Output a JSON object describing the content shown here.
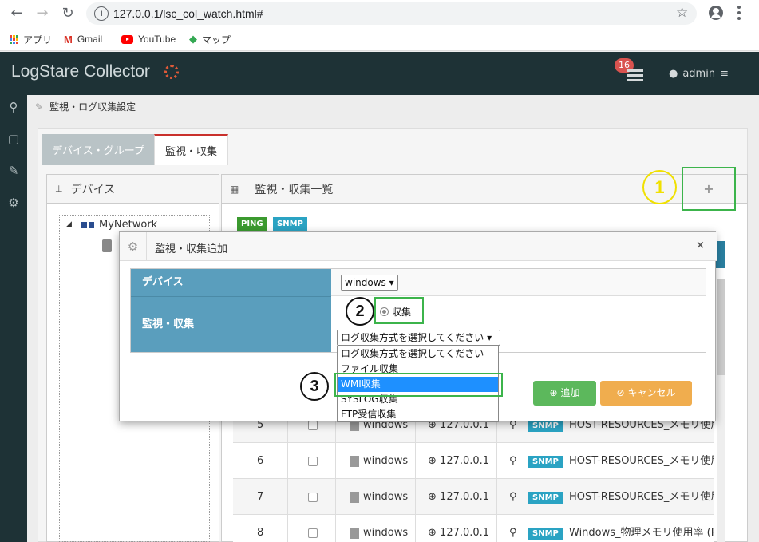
{
  "browser": {
    "url": "127.0.0.1/lsc_col_watch.html#",
    "bookmarks": [
      {
        "label": "アプリ"
      },
      {
        "label": "Gmail"
      },
      {
        "label": "YouTube"
      },
      {
        "label": "マップ"
      }
    ]
  },
  "header": {
    "brand": "LogStare Collector",
    "notification_count": "16",
    "user": "admin"
  },
  "breadcrumb": {
    "label": "監視・ログ収集設定"
  },
  "tabs": [
    {
      "label": "デバイス・グループ",
      "active": false
    },
    {
      "label": "監視・収集",
      "active": true
    }
  ],
  "left_panel": {
    "title": "デバイス",
    "tree": {
      "root": "MyNetwork"
    }
  },
  "right_panel": {
    "title": "監視・収集一覧",
    "add_symbol": "+",
    "chips": [
      "PING",
      "SNMP"
    ]
  },
  "annotations": {
    "one": "1",
    "two": "2",
    "three": "3"
  },
  "table": {
    "rows": [
      {
        "no": "5",
        "device": "windows",
        "ip": "127.0.0.1",
        "type": "SNMP",
        "name": "HOST-RESOURCES_メモリ使用率"
      },
      {
        "no": "6",
        "device": "windows",
        "ip": "127.0.0.1",
        "type": "SNMP",
        "name": "HOST-RESOURCES_メモリ使用率"
      },
      {
        "no": "7",
        "device": "windows",
        "ip": "127.0.0.1",
        "type": "SNMP",
        "name": "HOST-RESOURCES_メモリ使用率"
      },
      {
        "no": "8",
        "device": "windows",
        "ip": "127.0.0.1",
        "type": "SNMP",
        "name": "Windows_物理メモリ使用率 (Ph"
      }
    ]
  },
  "modal": {
    "title": "監視・収集追加",
    "close": "×",
    "device_label": "デバイス",
    "device_value": "windows ▾",
    "watch_label": "監視・収集",
    "radio_label": "収集",
    "select_value": "ログ収集方式を選択してください ▾",
    "options": [
      "ログ収集方式を選択してください",
      "ファイル収集",
      "WMI収集",
      "SYSLOG収集",
      "FTP受信収集"
    ],
    "selected_option": "WMI収集",
    "add_button": "追加",
    "cancel_button": "キャンセル"
  },
  "colors": {
    "header_bg": "#1e3236",
    "accent_blue": "#5a9ebd",
    "add_green": "#5cb85c",
    "cancel_orange": "#f0ad4e",
    "highlight_green": "#3cb44b",
    "annotation_yellow": "#f0e000"
  }
}
